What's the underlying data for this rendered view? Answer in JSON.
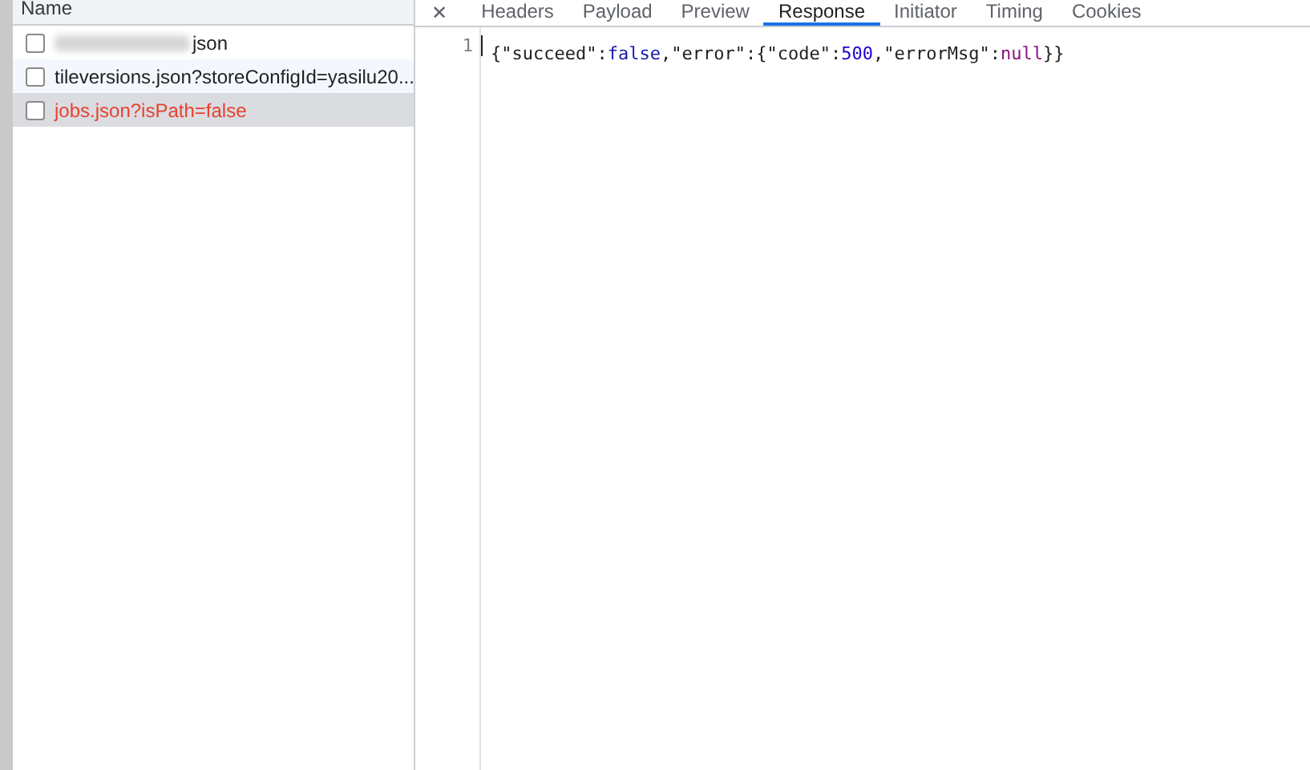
{
  "requests": {
    "column": "Name",
    "rows": [
      {
        "name": "json",
        "redacted": true,
        "selected": false,
        "error": false
      },
      {
        "name": "tileversions.json?storeConfigId=yasilu20...",
        "redacted": false,
        "selected": false,
        "error": false
      },
      {
        "name": "jobs.json?isPath=false",
        "redacted": false,
        "selected": true,
        "error": true
      }
    ]
  },
  "close": "✕",
  "tabs": [
    {
      "label": "Headers",
      "selected": false
    },
    {
      "label": "Payload",
      "selected": false
    },
    {
      "label": "Preview",
      "selected": false
    },
    {
      "label": "Response",
      "selected": true
    },
    {
      "label": "Initiator",
      "selected": false
    },
    {
      "label": "Timing",
      "selected": false
    },
    {
      "label": "Cookies",
      "selected": false
    }
  ],
  "response": {
    "lines": [
      {
        "number": "1",
        "tokens": [
          {
            "kind": "punct",
            "text": "{"
          },
          {
            "kind": "key",
            "text": "\"succeed\""
          },
          {
            "kind": "punct",
            "text": ":"
          },
          {
            "kind": "bool",
            "text": "false"
          },
          {
            "kind": "punct",
            "text": ","
          },
          {
            "kind": "key",
            "text": "\"error\""
          },
          {
            "kind": "punct",
            "text": ":{"
          },
          {
            "kind": "key",
            "text": "\"code\""
          },
          {
            "kind": "punct",
            "text": ":"
          },
          {
            "kind": "number",
            "text": "500"
          },
          {
            "kind": "punct",
            "text": ","
          },
          {
            "kind": "key",
            "text": "\"errorMsg\""
          },
          {
            "kind": "punct",
            "text": ":"
          },
          {
            "kind": "null",
            "text": "null"
          },
          {
            "kind": "punct",
            "text": "}}"
          }
        ]
      }
    ]
  }
}
